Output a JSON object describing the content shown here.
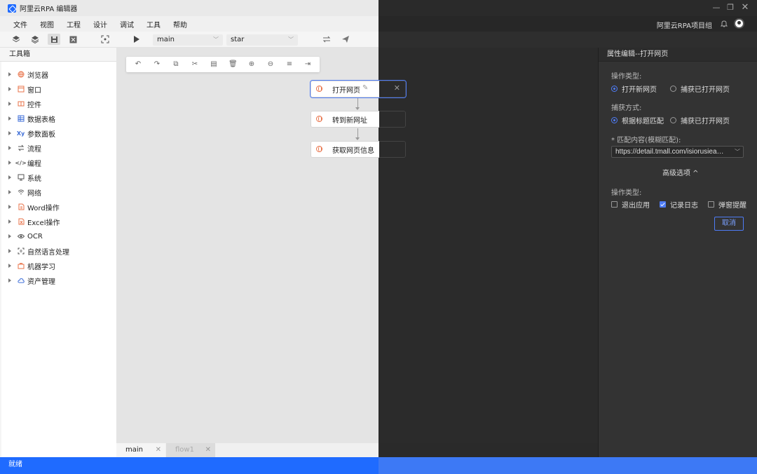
{
  "app": {
    "title": "阿里云RPA 编辑器"
  },
  "menu": {
    "items": [
      "文件",
      "视图",
      "工程",
      "设计",
      "调试",
      "工具",
      "帮助"
    ]
  },
  "header": {
    "project": "阿里云RPA项目组"
  },
  "toolbar": {
    "flow_select": "main",
    "target_select": "star"
  },
  "toolbox": {
    "title": "工具箱",
    "items": [
      {
        "label": "浏览器",
        "icon": "globe-icon"
      },
      {
        "label": "窗口",
        "icon": "window-icon"
      },
      {
        "label": "控件",
        "icon": "control-icon"
      },
      {
        "label": "数据表格",
        "icon": "table-icon"
      },
      {
        "label": "参数面板",
        "icon": "xy-icon"
      },
      {
        "label": "流程",
        "icon": "flow-icon"
      },
      {
        "label": "编程",
        "icon": "code-icon"
      },
      {
        "label": "系统",
        "icon": "monitor-icon"
      },
      {
        "label": "网络",
        "icon": "wifi-icon"
      },
      {
        "label": "Word操作",
        "icon": "word-icon"
      },
      {
        "label": "Excel操作",
        "icon": "excel-icon"
      },
      {
        "label": "OCR",
        "icon": "eye-icon"
      },
      {
        "label": "自然语言处理",
        "icon": "nlp-icon"
      },
      {
        "label": "机器学习",
        "icon": "ml-icon"
      },
      {
        "label": "资产管理",
        "icon": "cloud-icon"
      }
    ]
  },
  "flow": {
    "nodes": [
      {
        "label": "打开网页",
        "selected": true
      },
      {
        "label": "转到新网址",
        "selected": false
      },
      {
        "label": "获取网页信息",
        "selected": false
      }
    ]
  },
  "tabs": {
    "items": [
      {
        "label": "main"
      },
      {
        "label": "flow1"
      }
    ]
  },
  "status": {
    "text": "就绪"
  },
  "property": {
    "title": "属性编辑--打开网页",
    "op_type_label": "操作类型:",
    "op_type_options": [
      "打开新网页",
      "捕获已打开网页"
    ],
    "op_type_selected": 0,
    "capture_label": "捕获方式:",
    "capture_options": [
      "根据标题匹配",
      "捕获已打开网页"
    ],
    "capture_selected": 0,
    "match_label": "* 匹配内容(模糊匹配):",
    "match_value": "https://detail.tmall.com/isiorusiea…",
    "advanced_label": "高级选项 ^",
    "op_type2_label": "操作类型:",
    "checks": [
      {
        "label": "退出应用",
        "checked": false
      },
      {
        "label": "记录日志",
        "checked": true
      },
      {
        "label": "弹窗提醒",
        "checked": false
      }
    ],
    "cancel_label": "取消"
  },
  "colors": {
    "accent": "#1f6bff",
    "panel_dark": "#333333",
    "canvas_light": "#e4e4e4",
    "node_icon": "#e8734a"
  }
}
